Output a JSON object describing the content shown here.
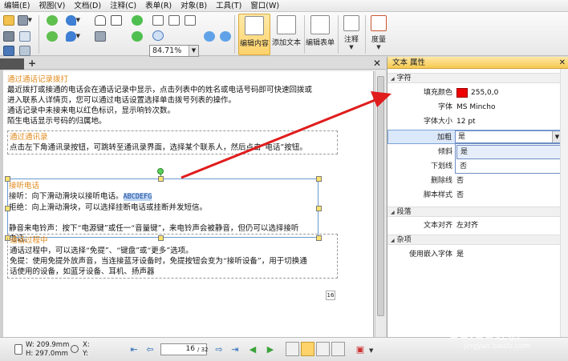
{
  "menu": [
    "编辑(E)",
    "视图(V)",
    "文档(D)",
    "注释(C)",
    "表单(R)",
    "对象(B)",
    "工具(T)",
    "窗口(W)"
  ],
  "toolbar": {
    "zoom": "84.71%",
    "edit_content": "编辑内容",
    "add_text": "添加文本",
    "edit_form": "编辑表单",
    "annotate": "注释",
    "measure": "度量"
  },
  "document": {
    "block1": {
      "head": "通过通话记录拨打",
      "lines": [
        "最近拨打或接通的电话会在通话记录中显示，点击列表中的姓名或电话号码即可快速回拨或",
        "进入联系人详情页，您可以通过电话设置选择单击拨号列表的操作。",
        "通话记录中未接来电以红色标识，显示响铃次数。",
        "陌生电话显示号码的归属地。"
      ]
    },
    "block2": {
      "head": "通过通讯录",
      "lines": [
        "点击左下角通讯录按钮，可跳转至通讯录界面，选择某个联系人，然后点击“电话”按钮。"
      ]
    },
    "block3": {
      "head": "接听电话",
      "line1_prefix": "接听：向下滑动滑块以接听电话。",
      "highlight": "ABCDEFG",
      "lines": [
        "拒绝：向上滑动滑块，可以选择挂断电话或挂断并发短信。",
        "",
        "静音来电铃声：按下“电源键”或任一“音量键”，来电铃声会被静音，但仍可以选择接听",
        "电话。"
      ]
    },
    "block4": {
      "head": "通话过程中",
      "lines": [
        "通话过程中，可以选择“免提”、“键盘”或“更多”选项。",
        "免提：使用免提外放声音，当连接蓝牙设备时，免提按钮会变为“接听设备”，用于切换通",
        "话使用的设备，如蓝牙设备、耳机、扬声器"
      ]
    },
    "page_badge": "16"
  },
  "statusbar": {
    "width": "W: 209.9mm",
    "height": "H: 297.0mm",
    "x": "X:",
    "y": "Y:",
    "page_current": "16",
    "page_total": "/ 32"
  },
  "props": {
    "title": "文本 属性",
    "section_char": "字符",
    "fill_color_label": "填充颜色",
    "fill_color_value": "255,0,0",
    "fill_color_hex": "#ee0000",
    "font_label": "字体",
    "font_value": "MS Mincho",
    "size_label": "字体大小",
    "size_value": "12 pt",
    "bold_label": "加粗",
    "bold_value": "是",
    "italic_label": "倾斜",
    "underline_label": "下划线",
    "strike_label": "删除线",
    "strike_value": "否",
    "superscript_label": "脚本样式",
    "superscript_value": "否",
    "options": [
      "是",
      "否"
    ],
    "section_para": "段落",
    "align_label": "文本对齐",
    "align_value": "左对齐",
    "section_misc": "杂项",
    "embed_label": "使用嵌入字体",
    "embed_value": "是"
  },
  "watermark": {
    "main": "Baidu经验",
    "sub": "jingyan.baidu.com"
  }
}
